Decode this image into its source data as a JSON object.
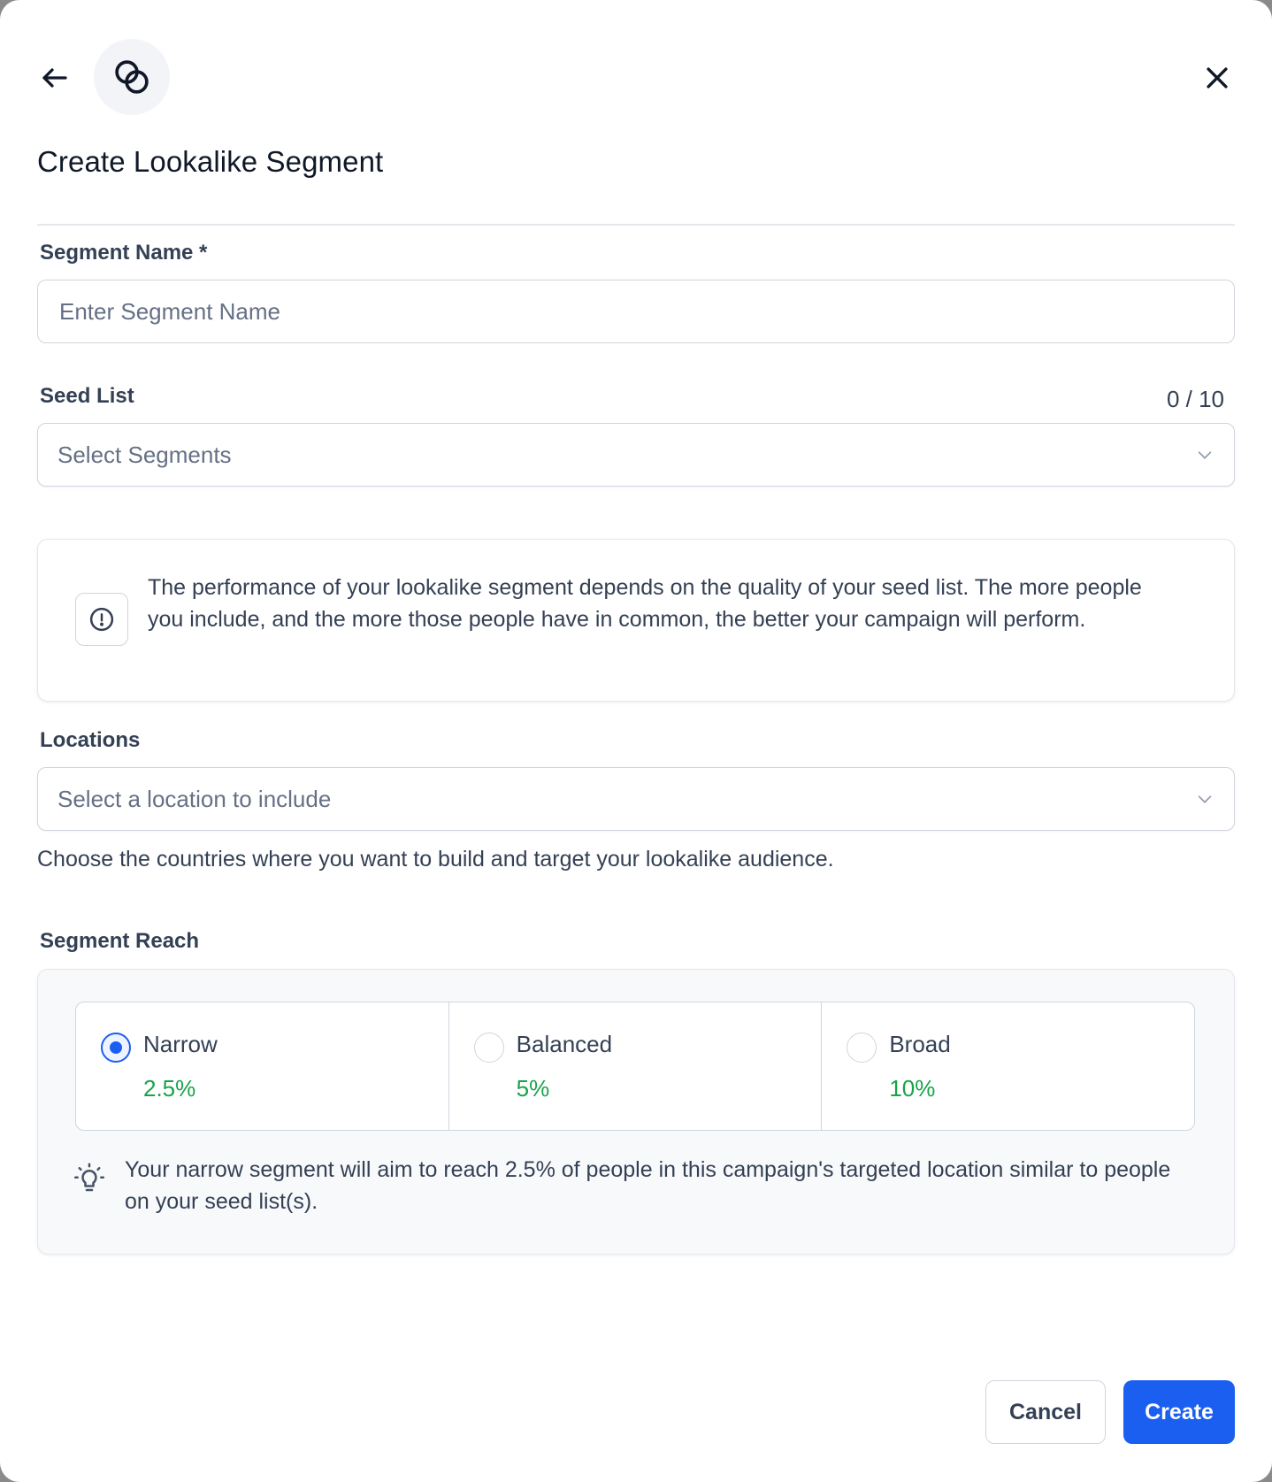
{
  "header": {
    "title": "Create Lookalike Segment",
    "back_icon": "arrow-left-icon",
    "logo_icon": "overlapping-circles-icon",
    "close_icon": "close-icon"
  },
  "segment_name": {
    "label": "Segment Name *",
    "placeholder": "Enter Segment Name",
    "value": ""
  },
  "seed_list": {
    "label": "Seed List",
    "counter": "0 / 10",
    "placeholder": "Select Segments"
  },
  "info": {
    "text": "The performance of your lookalike segment depends on the quality of your seed list. The more people you include, and the more those people have in common, the better your campaign will perform."
  },
  "locations": {
    "label": "Locations",
    "placeholder": "Select a location to include",
    "helper": "Choose the countries where you want to build and target your lookalike audience."
  },
  "segment_reach": {
    "label": "Segment Reach",
    "selected": "Narrow",
    "options": [
      {
        "name": "Narrow",
        "percent": "2.5%"
      },
      {
        "name": "Balanced",
        "percent": "5%"
      },
      {
        "name": "Broad",
        "percent": "10%"
      }
    ],
    "tip": "Your narrow segment will aim to reach 2.5% of people in this campaign's targeted location similar to people on your seed list(s)."
  },
  "footer": {
    "cancel_label": "Cancel",
    "create_label": "Create"
  },
  "colors": {
    "primary": "#1a5ff0",
    "success": "#17a34a"
  }
}
